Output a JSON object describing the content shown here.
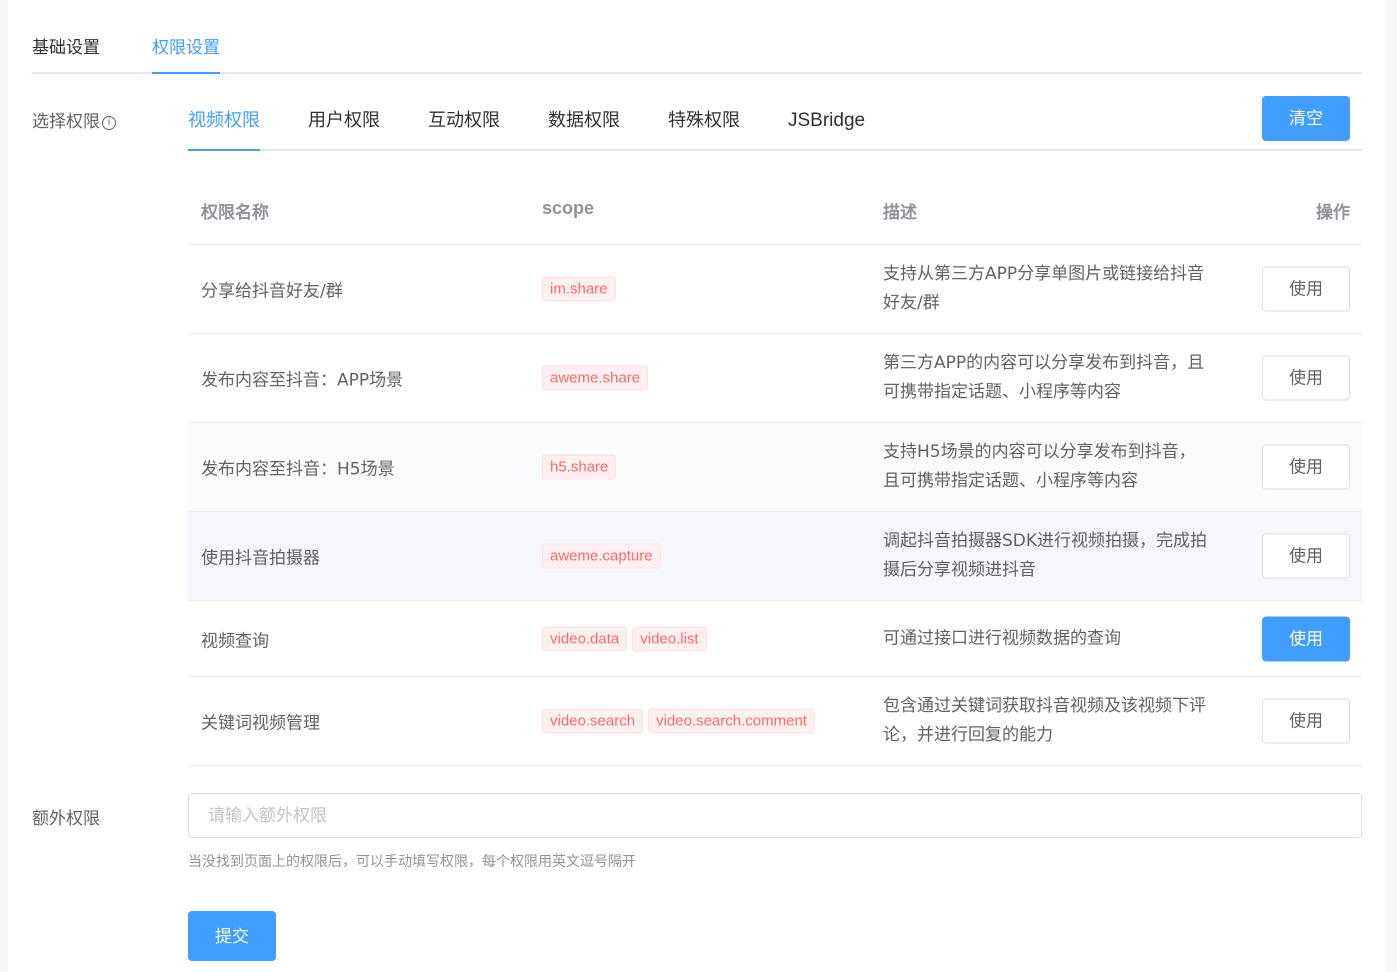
{
  "top_tabs": [
    {
      "label": "基础设置",
      "active": false
    },
    {
      "label": "权限设置",
      "active": true
    }
  ],
  "form": {
    "select_permission_label": "选择权限",
    "extra_permission_label": "额外权限",
    "extra_placeholder": "请输入额外权限",
    "extra_value": "",
    "hint": "当没找到页面上的权限后，可以手动填写权限，每个权限用英文逗号隔开",
    "submit_label": "提交"
  },
  "perm_tabs": [
    {
      "label": "视频权限",
      "active": true
    },
    {
      "label": "用户权限",
      "active": false
    },
    {
      "label": "互动权限",
      "active": false
    },
    {
      "label": "数据权限",
      "active": false
    },
    {
      "label": "特殊权限",
      "active": false
    },
    {
      "label": "JSBridge",
      "active": false
    }
  ],
  "clear_label": "清空",
  "table": {
    "headers": {
      "name": "权限名称",
      "scope": "scope",
      "desc": "描述",
      "action": "操作"
    },
    "rows": [
      {
        "name": "分享给抖音好友/群",
        "scopes": [
          "im.share"
        ],
        "desc": "支持从第三方APP分享单图片或链接给抖音好友/群",
        "action": "使用",
        "selected": false
      },
      {
        "name": "发布内容至抖音：APP场景",
        "scopes": [
          "aweme.share"
        ],
        "desc": "第三方APP的内容可以分享发布到抖音，且可携带指定话题、小程序等内容",
        "action": "使用",
        "selected": false
      },
      {
        "name": "发布内容至抖音：H5场景",
        "scopes": [
          "h5.share"
        ],
        "desc": "支持H5场景的内容可以分享发布到抖音，且可携带指定话题、小程序等内容",
        "action": "使用",
        "selected": false
      },
      {
        "name": "使用抖音拍摄器",
        "scopes": [
          "aweme.capture"
        ],
        "desc": "调起抖音拍摄器SDK进行视频拍摄，完成拍摄后分享视频进抖音",
        "action": "使用",
        "selected": false
      },
      {
        "name": "视频查询",
        "scopes": [
          "video.data",
          "video.list"
        ],
        "desc": "可通过接口进行视频数据的查询",
        "action": "使用",
        "selected": true
      },
      {
        "name": "关键词视频管理",
        "scopes": [
          "video.search",
          "video.search.comment"
        ],
        "desc": "包含通过关键词获取抖音视频及该视频下评论，并进行回复的能力",
        "action": "使用",
        "selected": false
      }
    ]
  },
  "colors": {
    "accent": "#409eff",
    "tag_text": "#f56c6c",
    "tag_bg": "#fef0f0"
  },
  "icons": {
    "info": "info-circle-icon"
  }
}
